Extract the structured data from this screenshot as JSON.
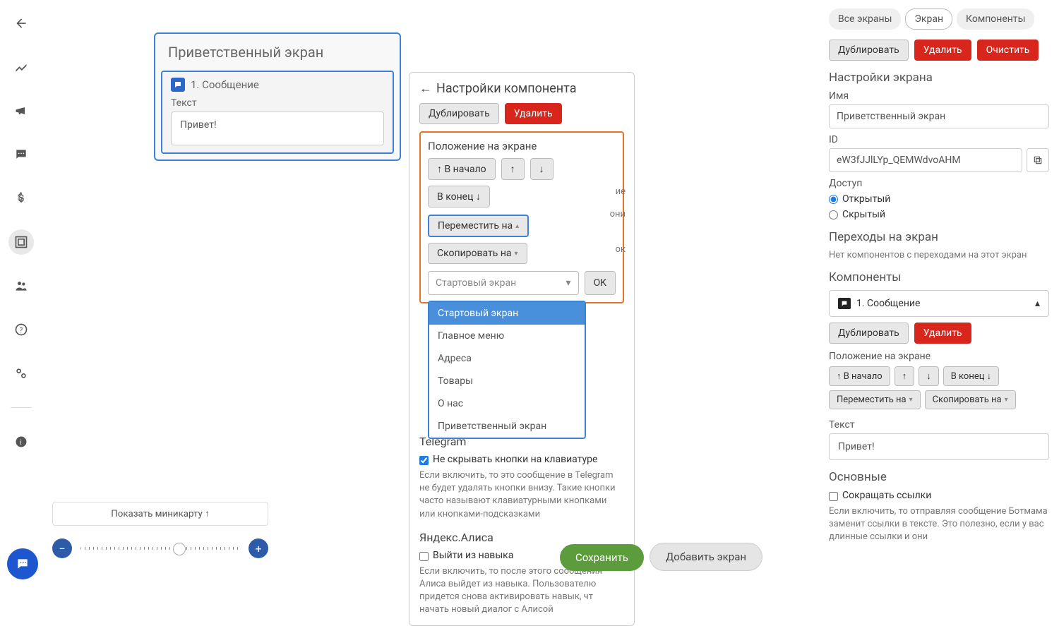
{
  "sidebar_nav": {
    "items": [
      "back",
      "chart",
      "megaphone",
      "chat",
      "dollar",
      "diagram",
      "users",
      "help",
      "settings",
      "info"
    ]
  },
  "canvas": {
    "screen_card": {
      "title": "Приветственный экран",
      "component_label": "1. Сообщение",
      "text_label": "Текст",
      "text_value": "Привет!"
    },
    "component_settings": {
      "title": "Настройки компонента",
      "duplicate_label": "Дублировать",
      "delete_label": "Удалить",
      "position_title": "Положение на экране",
      "to_start_label": "↑ В начало",
      "up_label": "↑",
      "down_label": "↓",
      "to_end_label": "В конец ↓",
      "move_to_label": "Переместить на",
      "copy_to_label": "Скопировать на",
      "select_placeholder": "Стартовый экран",
      "ok_label": "OK",
      "dropdown": [
        "Стартовый экран",
        "Главное меню",
        "Адреса",
        "Товары",
        "О нас",
        "Приветственный экран"
      ],
      "hidden_line1_end": "ие",
      "hidden_line2_end": "они",
      "hidden_line3_end": "ок",
      "tg_title": "Telegram",
      "tg_cb_label": "Не скрывать кнопки на клавиатуре",
      "tg_desc": "Если включить, то это сообщение в Telegram не будет удалять кнопки внизу. Такие кнопки часто называют клавиатурными кнопками или кнопками-подсказками",
      "ya_title": "Яндекс.Алиса",
      "ya_cb_label": "Выйти из навыка",
      "ya_desc": "Если включить, то после этого сообщения Алиса выйдет из навыка. Пользователю придется снова активировать навык, чт начать новый диалог с Алисой"
    },
    "minimap_label": "Показать миникарту ↑",
    "save_label": "Сохранить",
    "add_screen_label": "Добавить экран"
  },
  "right_panel": {
    "tabs": [
      "Все экраны",
      "Экран",
      "Компоненты"
    ],
    "active_tab": 1,
    "duplicate_label": "Дублировать",
    "delete_label": "Удалить",
    "clear_label": "Очистить",
    "settings_title": "Настройки экрана",
    "name_label": "Имя",
    "name_value": "Приветственный экран",
    "id_label": "ID",
    "id_value": "eW3fJJlLYp_QEMWdvoAHM",
    "access_label": "Доступ",
    "access_open": "Открытый",
    "access_hidden": "Скрытый",
    "transitions_title": "Переходы на экран",
    "transitions_empty": "Нет компонентов с переходами на этот экран",
    "components_title": "Компоненты",
    "component_item_label": "1. Сообщение",
    "duplicate2_label": "Дублировать",
    "delete2_label": "Удалить",
    "position_label": "Положение на экране",
    "to_start_label": "↑ В начало",
    "up_label": "↑",
    "down_label": "↓",
    "to_end_label": "В конец ↓",
    "move_to_label": "Переместить на",
    "copy_to_label": "Скопировать на",
    "text_label": "Текст",
    "text_value": "Привет!",
    "main_title": "Основные",
    "shorten_links_label": "Сокращать ссылки",
    "shorten_desc": "Если включить, то отправляя сообщение Ботмама заменит ссылки в тексте. Это полезно, если у вас длинные ссылки и они"
  }
}
